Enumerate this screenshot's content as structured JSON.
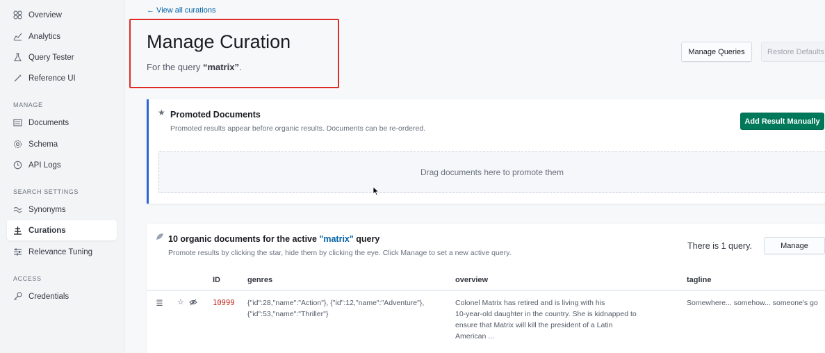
{
  "sidebar": {
    "items_top": [
      {
        "label": "Overview",
        "icon": "overview-icon"
      },
      {
        "label": "Analytics",
        "icon": "analytics-icon"
      },
      {
        "label": "Query Tester",
        "icon": "flask-icon"
      },
      {
        "label": "Reference UI",
        "icon": "wand-icon"
      }
    ],
    "section_manage": "MANAGE",
    "items_manage": [
      {
        "label": "Documents",
        "icon": "documents-icon"
      },
      {
        "label": "Schema",
        "icon": "gear-icon"
      },
      {
        "label": "API Logs",
        "icon": "clock-icon"
      }
    ],
    "section_search": "SEARCH SETTINGS",
    "items_search": [
      {
        "label": "Synonyms",
        "icon": "synonyms-icon"
      },
      {
        "label": "Curations",
        "icon": "curations-icon",
        "active": true
      },
      {
        "label": "Relevance Tuning",
        "icon": "sliders-icon"
      }
    ],
    "section_access": "ACCESS",
    "items_access": [
      {
        "label": "Credentials",
        "icon": "key-icon"
      }
    ]
  },
  "header": {
    "back_link": "← View all curations",
    "title": "Manage Curation",
    "subtitle_prefix": "For the query ",
    "subtitle_query": "“matrix”",
    "subtitle_suffix": ".",
    "manage_queries_label": "Manage Queries",
    "restore_defaults_label": "Restore Defaults"
  },
  "promoted": {
    "title": "Promoted Documents",
    "description": "Promoted results appear before organic results. Documents can be re-ordered.",
    "add_button_label": "Add Result Manually",
    "drop_zone_text": "Drag documents here to promote them"
  },
  "organic": {
    "title_prefix": "10 organic documents for the active ",
    "title_query": "\"matrix\"",
    "title_suffix": " query",
    "description": "Promote results by clicking the star, hide them by clicking the eye. Click Manage to set a new active query.",
    "query_count": "There is 1 query.",
    "manage_label": "Manage",
    "columns": [
      "ID",
      "genres",
      "overview",
      "tagline"
    ],
    "rows": [
      {
        "id": "10999",
        "genres_line1": "{\"id\":28,\"name\":\"Action\"}, {\"id\":12,\"name\":\"Adventure\"},",
        "genres_line2": "{\"id\":53,\"name\":\"Thriller\"}",
        "overview_line1": "Colonel Matrix has retired and is living with his",
        "overview_line2": "10-year-old daughter in the country. She is kidnapped to",
        "overview_line3": "ensure that Matrix will kill the president of a Latin",
        "overview_line4": "American ...",
        "tagline": "Somewhere... somehow... someone's go"
      }
    ]
  },
  "colors": {
    "accent_blue": "#2c66d8",
    "link_blue": "#0061a6",
    "primary_green": "#00785a",
    "highlight_red": "#e02a24",
    "id_red": "#bd271e"
  }
}
